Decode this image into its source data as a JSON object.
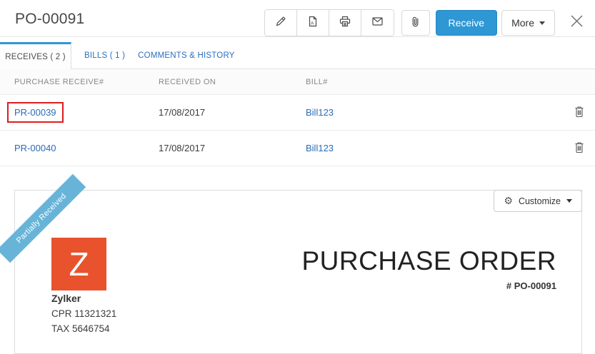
{
  "header": {
    "title": "PO-00091",
    "toolbar": {
      "icons": [
        "edit",
        "pdf",
        "print",
        "email",
        "attachment"
      ],
      "receive_label": "Receive",
      "more_label": "More"
    }
  },
  "tabs": [
    {
      "label": "RECEIVES ( 2 )",
      "active": true
    },
    {
      "label": "BILLS ( 1 )",
      "active": false
    },
    {
      "label": "COMMENTS & HISTORY",
      "active": false
    }
  ],
  "table": {
    "columns": [
      "PURCHASE RECEIVE#",
      "RECEIVED ON",
      "BILL#"
    ],
    "rows": [
      {
        "receive_no": "PR-00039",
        "received_on": "17/08/2017",
        "bill_no": "Bill123",
        "highlighted": true
      },
      {
        "receive_no": "PR-00040",
        "received_on": "17/08/2017",
        "bill_no": "Bill123",
        "highlighted": false
      }
    ]
  },
  "preview": {
    "ribbon_label": "Partially Received",
    "customize_label": "Customize",
    "logo_letter": "Z",
    "company_name": "Zylker",
    "company_cpr": "CPR 11321321",
    "company_tax": "TAX 5646754",
    "doc_title": "PURCHASE ORDER",
    "doc_number": "# PO-00091"
  },
  "colors": {
    "accent_blue": "#2e97d4",
    "link_blue": "#2b6bb5",
    "ribbon_blue": "#68b4d8",
    "logo_orange": "#e8532e",
    "highlight_red": "#dd1c1c"
  }
}
